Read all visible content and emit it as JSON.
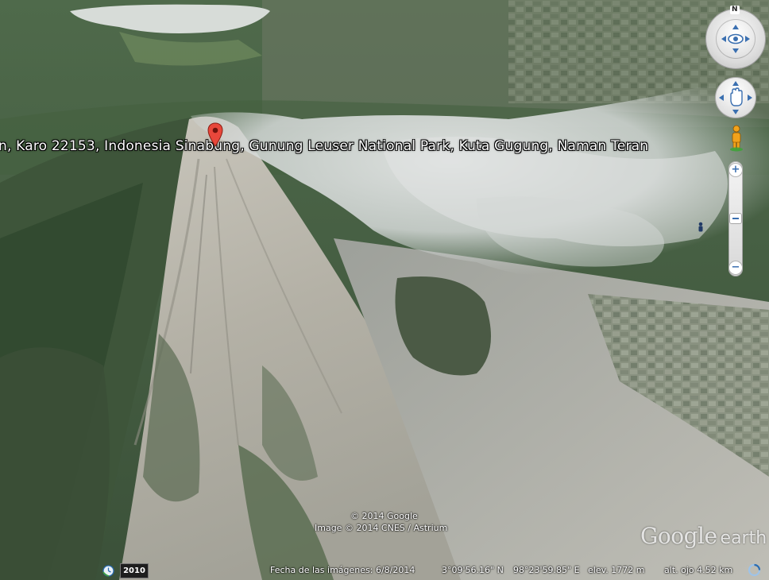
{
  "app": {
    "name": "Google Earth"
  },
  "placemark": {
    "label": "n, Karo 22153, Indonesia  Sinabung, Gunung Leuser National Park, Kuta Gugung, Naman Teran"
  },
  "navigation": {
    "compass_north": "N",
    "zoom_in": "+",
    "zoom_out": "−",
    "zoom_bottom": "−"
  },
  "overlay": {
    "copyright_1": "© 2014 Google",
    "copyright_2": "Image © 2014 CNES / Astrium",
    "logo_main": "Google",
    "logo_suffix": "earth"
  },
  "status_bar": {
    "historical_year": "2010",
    "imagery_date": "Fecha de las imágenes: 6/8/2014",
    "latitude": "3°09'56.16\" N",
    "longitude": "98°23'59.85\" E",
    "elevation": "elev.  1772 m",
    "eye_altitude": "alt. ojo   4.52 km"
  },
  "colors": {
    "pin": "#e8473b",
    "pegman": "#f2a21b",
    "control_accent": "#3a6fb0",
    "forest": "#3f5a3c",
    "ash": "#b9b6ab",
    "cloud": "#dcdfdf"
  }
}
